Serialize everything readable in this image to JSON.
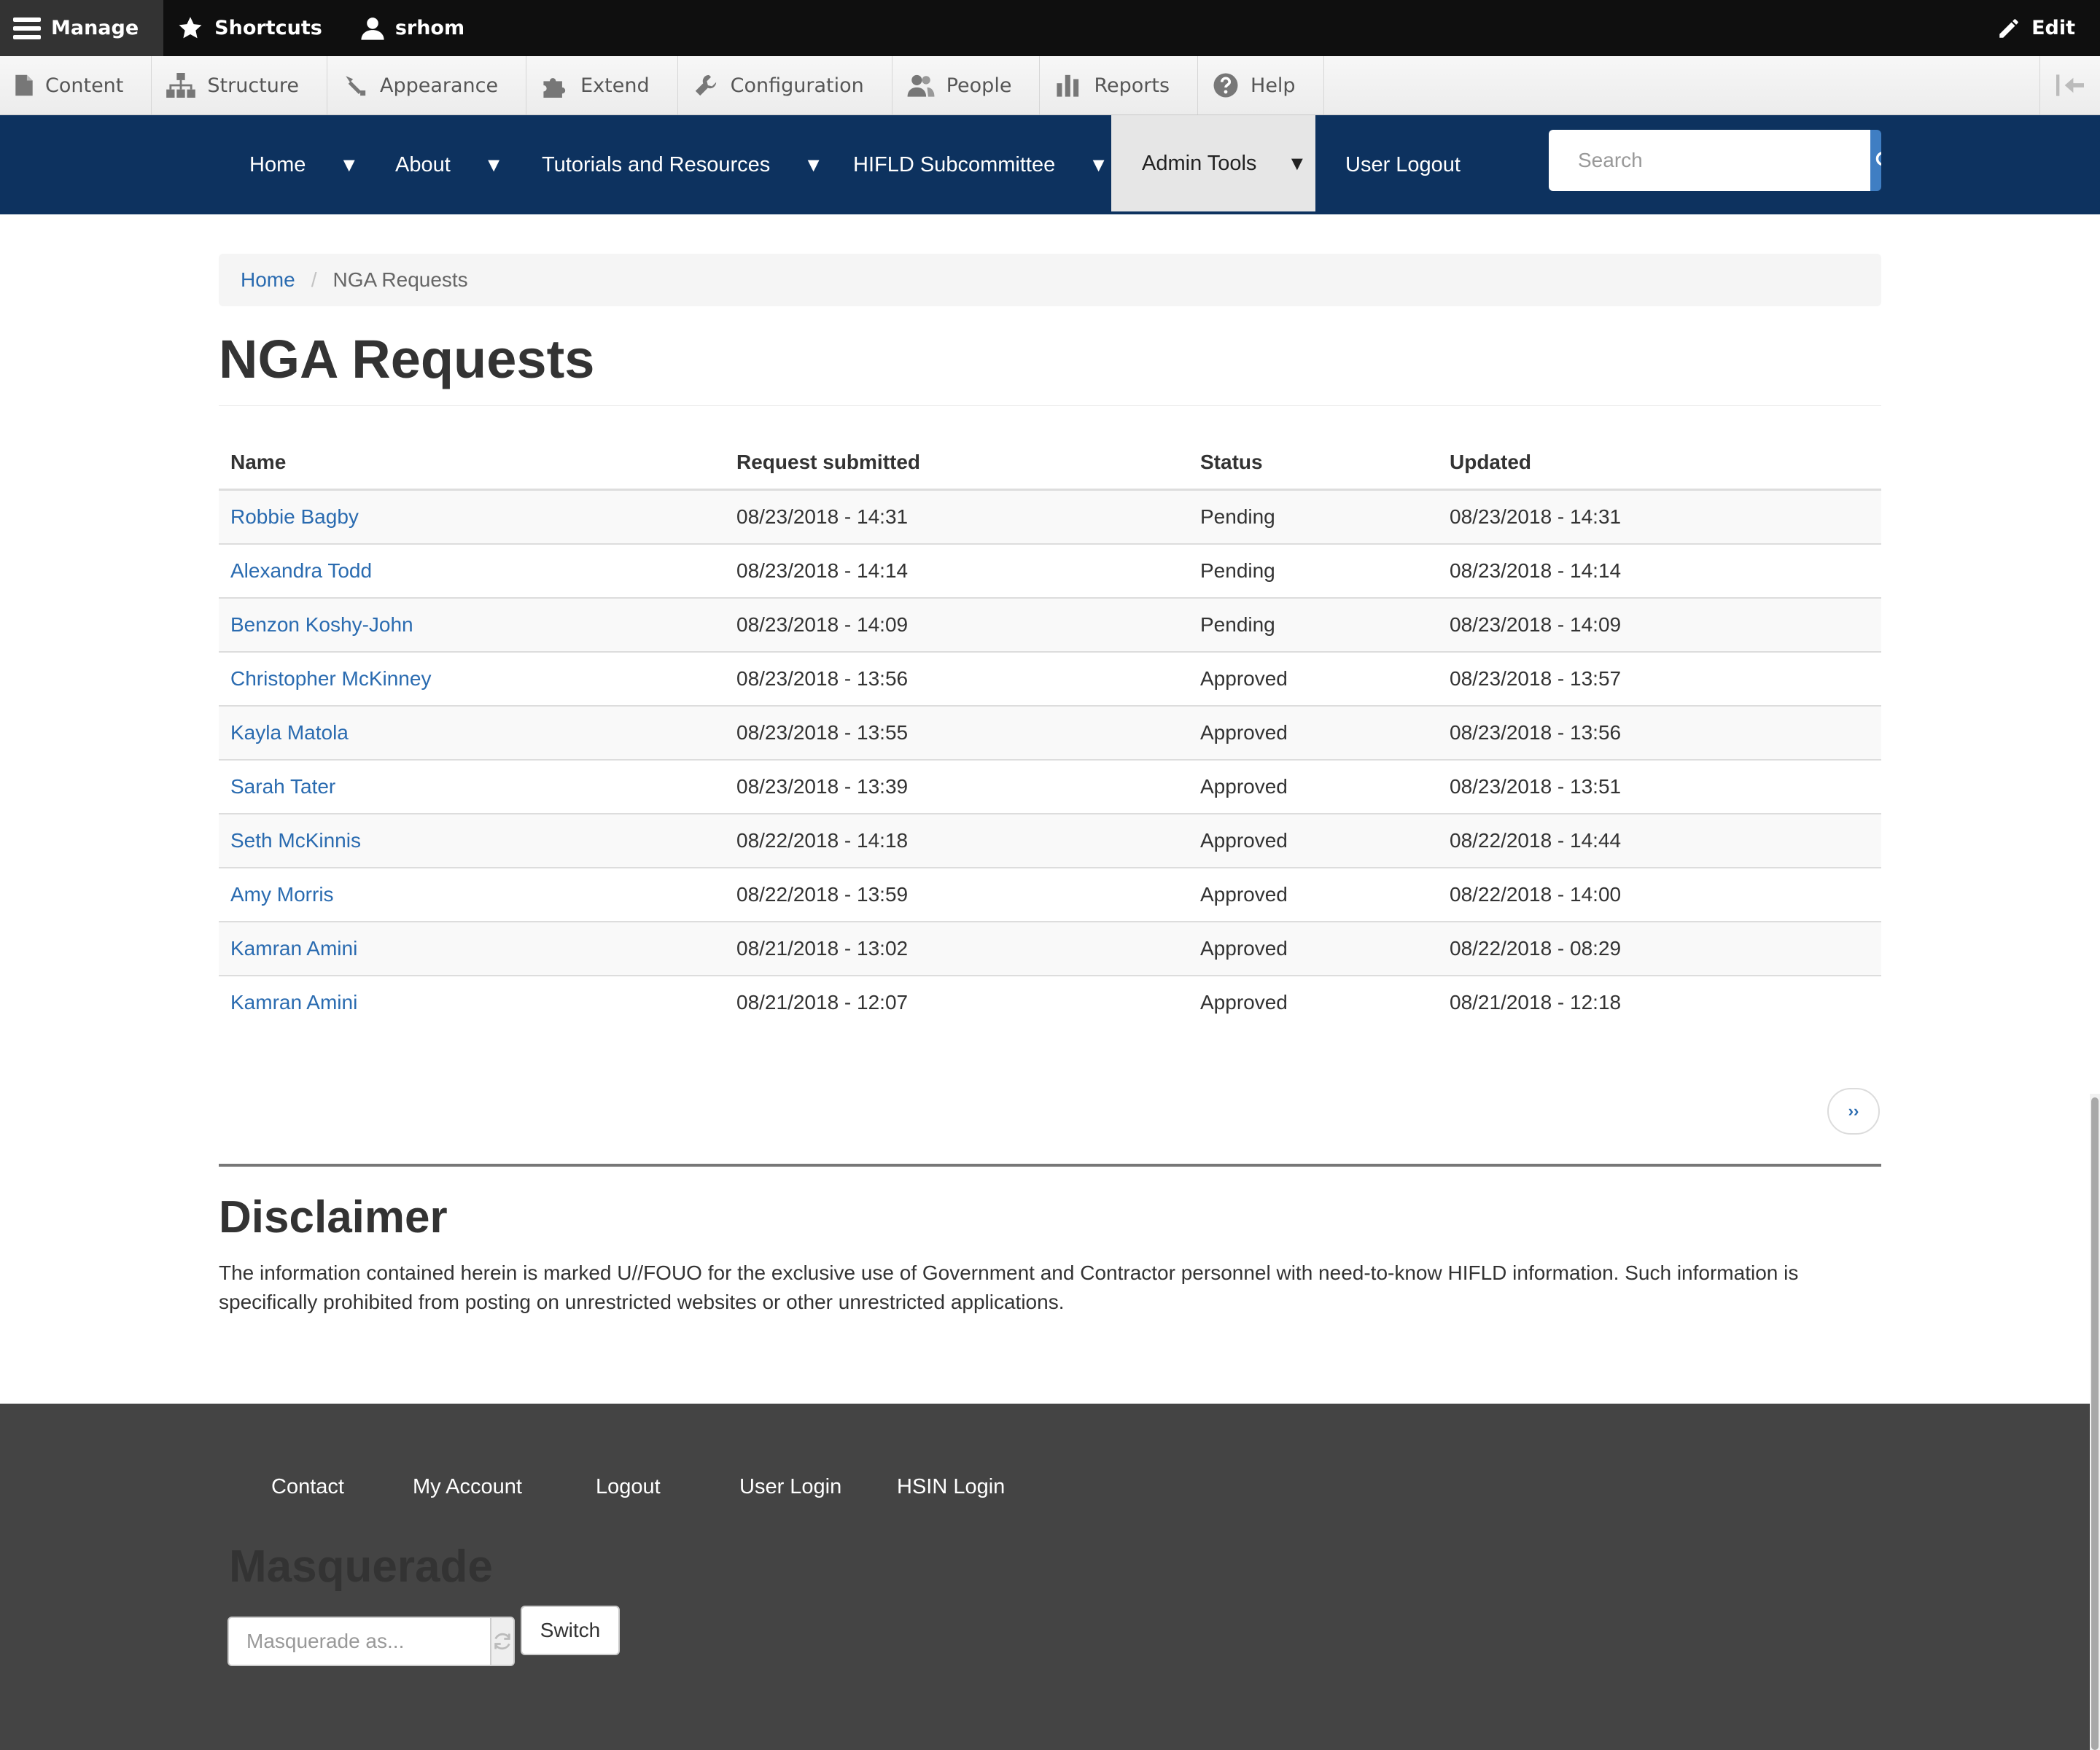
{
  "toolbar": {
    "manage": "Manage",
    "shortcuts": "Shortcuts",
    "user": "srhom",
    "edit": "Edit"
  },
  "tray": {
    "items": [
      "Content",
      "Structure",
      "Appearance",
      "Extend",
      "Configuration",
      "People",
      "Reports",
      "Help"
    ]
  },
  "nav": {
    "items": [
      "Home",
      "About",
      "Tutorials and Resources",
      "HIFLD Subcommittee",
      "Admin Tools",
      "User Logout"
    ],
    "caret": "▼",
    "search_placeholder": "Search"
  },
  "breadcrumb": {
    "home": "Home",
    "separator": "/",
    "current": "NGA Requests"
  },
  "page": {
    "title": "NGA Requests"
  },
  "table": {
    "headers": [
      "Name",
      "Request submitted",
      "Status",
      "Updated"
    ],
    "rows": [
      [
        "Robbie Bagby",
        "08/23/2018 - 14:31",
        "Pending",
        "08/23/2018 - 14:31"
      ],
      [
        "Alexandra Todd",
        "08/23/2018 - 14:14",
        "Pending",
        "08/23/2018 - 14:14"
      ],
      [
        "Benzon Koshy-John",
        "08/23/2018 - 14:09",
        "Pending",
        "08/23/2018 - 14:09"
      ],
      [
        "Christopher McKinney",
        "08/23/2018 - 13:56",
        "Approved",
        "08/23/2018 - 13:57"
      ],
      [
        "Kayla Matola",
        "08/23/2018 - 13:55",
        "Approved",
        "08/23/2018 - 13:56"
      ],
      [
        "Sarah Tater",
        "08/23/2018 - 13:39",
        "Approved",
        "08/23/2018 - 13:51"
      ],
      [
        "Seth McKinnis",
        "08/22/2018 - 14:18",
        "Approved",
        "08/22/2018 - 14:44"
      ],
      [
        "Amy Morris",
        "08/22/2018 - 13:59",
        "Approved",
        "08/22/2018 - 14:00"
      ],
      [
        "Kamran Amini",
        "08/21/2018 - 13:02",
        "Approved",
        "08/22/2018 - 08:29"
      ],
      [
        "Kamran Amini",
        "08/21/2018 - 12:07",
        "Approved",
        "08/21/2018 - 12:18"
      ]
    ]
  },
  "pager": {
    "next": "››"
  },
  "disclaimer": {
    "title": "Disclaimer",
    "text": "The information contained herein is marked U//FOUO for the exclusive use of Government and Contractor personnel with need-to-know HIFLD information. Such information is specifically prohibited from posting on unrestricted websites or other unrestricted applications."
  },
  "footer": {
    "links": [
      "Contact",
      "My Account",
      "Logout",
      "User Login",
      "HSIN Login"
    ]
  },
  "masquerade": {
    "title": "Masquerade",
    "placeholder": "Masquerade as...",
    "switch_label": "Switch"
  },
  "colors": {
    "toolbar_bg": "#0f0f0f",
    "navbar_bg": "#0d325f",
    "link": "#2a6bb0",
    "search_button": "#3f7ec3",
    "footer_bg": "#444444"
  }
}
